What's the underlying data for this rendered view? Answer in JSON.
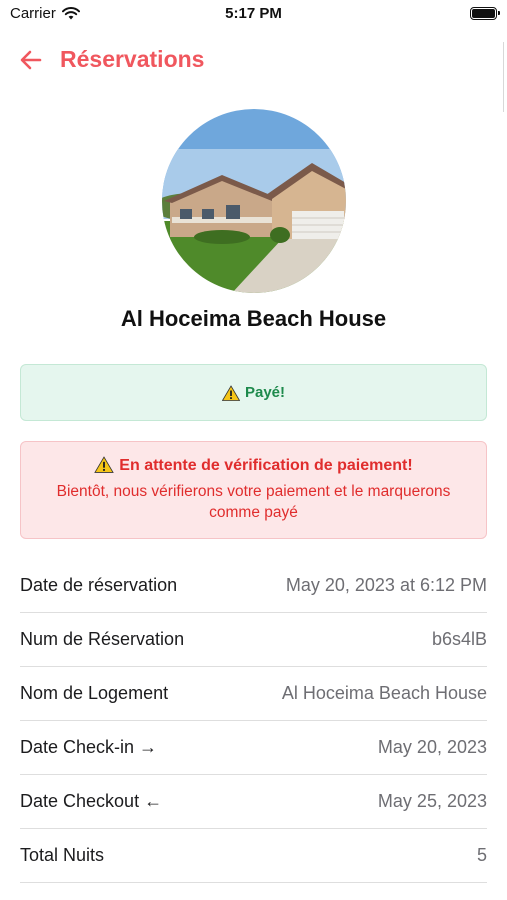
{
  "status_bar": {
    "carrier": "Carrier",
    "time": "5:17 PM"
  },
  "nav": {
    "title": "Réservations"
  },
  "property": {
    "name": "Al Hoceima Beach House"
  },
  "alerts": {
    "success": "Payé!",
    "pending_title": "En attente de vérification de paiement!",
    "pending_message": "Bientôt, nous vérifierons votre paiement et le marquerons comme payé"
  },
  "details": [
    {
      "label": "Date de réservation",
      "value": "May 20, 2023 at 6:12 PM"
    },
    {
      "label": "Num de Réservation",
      "value": "b6s4lB"
    },
    {
      "label": "Nom de Logement",
      "value": "Al Hoceima Beach House"
    },
    {
      "label": "Date Check-in →",
      "value": "May 20, 2023"
    },
    {
      "label": "Date Checkout ←",
      "value": "May 25, 2023"
    },
    {
      "label": "Total Nuits",
      "value": "5"
    }
  ],
  "colors": {
    "accent": "#f0575e",
    "success_bg": "#e5f6ee",
    "success_text": "#1e8a4c",
    "danger_bg": "#fde7e8",
    "danger_text": "#e02d2d"
  },
  "icons": [
    "back-arrow-icon",
    "wifi-icon",
    "battery-icon",
    "warning-icon"
  ]
}
